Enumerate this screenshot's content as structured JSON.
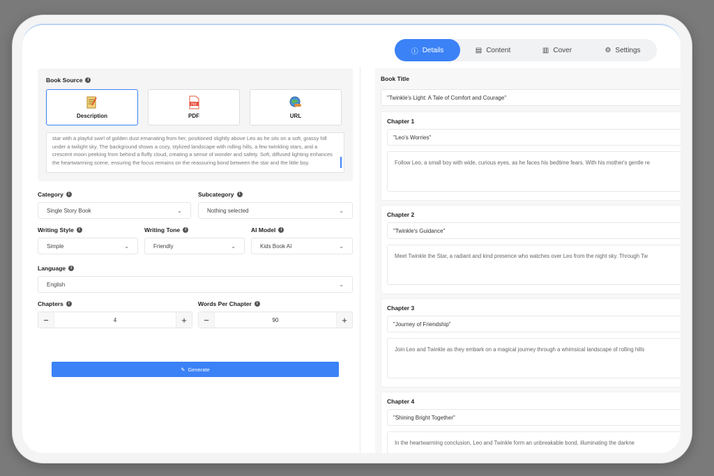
{
  "tabs": [
    {
      "label": "Details",
      "icon": "info-icon",
      "active": true
    },
    {
      "label": "Content",
      "icon": "document-icon",
      "active": false
    },
    {
      "label": "Cover",
      "icon": "book-icon",
      "active": false
    },
    {
      "label": "Settings",
      "icon": "gear-icon",
      "active": false
    }
  ],
  "book_source": {
    "label": "Book Source",
    "options": [
      {
        "label": "Description",
        "icon": "description-icon",
        "selected": true
      },
      {
        "label": "PDF",
        "icon": "pdf-icon",
        "selected": false
      },
      {
        "label": "URL",
        "icon": "url-icon",
        "selected": false
      }
    ],
    "description_text": "star with a playful swirl of golden dust emanating from her, positioned slightly above Leo as he sits on a soft, grassy hill under a twilight sky.  The background shows a cozy, stylized landscape with rolling hills, a few twinkling stars, and a crescent moon peeking from behind a fluffy cloud, creating a sense of wonder and safety. Soft, diffused lighting enhances the heartwarming scene, ensuring the focus remains on the reassuring bond between the star and the little boy."
  },
  "form": {
    "category": {
      "label": "Category",
      "value": "Single Story Book"
    },
    "subcategory": {
      "label": "Subcategory",
      "value": "Nothing selected"
    },
    "writing_style": {
      "label": "Writing Style",
      "value": "Simple"
    },
    "writing_tone": {
      "label": "Writing Tone",
      "value": "Friendly"
    },
    "ai_model": {
      "label": "AI Model",
      "value": "Kids Book AI"
    },
    "language": {
      "label": "Language",
      "value": "English"
    },
    "chapters": {
      "label": "Chapters",
      "value": "4"
    },
    "words_per_chapter": {
      "label": "Words Per Chapter",
      "value": "90"
    },
    "generate_label": "Generate"
  },
  "book": {
    "title_label": "Book Title",
    "title": "\"Twinkle's Light: A Tale of Comfort and Courage\"",
    "chapters": [
      {
        "label": "Chapter 1",
        "title": "\"Leo's Worries\"",
        "body": "Follow Leo, a small boy with wide, curious eyes, as he faces his bedtime fears. With his mother's gentle re"
      },
      {
        "label": "Chapter 2",
        "title": "\"Twinkle's Guidance\"",
        "body": "Meet Twinkle the Star, a radiant and kind presence who watches over Leo from the night sky. Through Tw"
      },
      {
        "label": "Chapter 3",
        "title": "\"Journey of Friendship\"",
        "body": "Join Leo and Twinkle as they embark on a magical journey through a whimsical landscape of rolling hills"
      },
      {
        "label": "Chapter 4",
        "title": "\"Shining Bright Together\"",
        "body": "In the heartwarming conclusion, Leo and Twinkle form an unbreakable bond, illuminating the darkne"
      }
    ]
  },
  "colors": {
    "accent": "#3b82f6",
    "frame": "#7a7a7a"
  }
}
